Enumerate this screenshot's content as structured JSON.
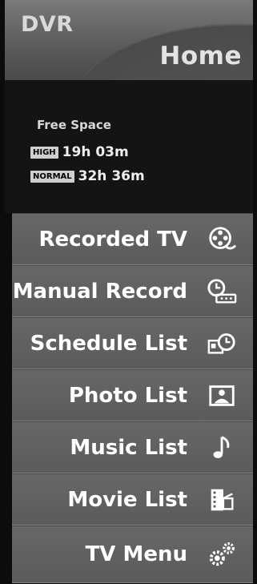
{
  "header": {
    "app": "DVR",
    "title": "Home"
  },
  "status": {
    "free_space_label": "Free Space",
    "high_badge": "HIGH",
    "high_time": "19h 03m",
    "normal_badge": "NORMAL",
    "normal_time": "32h 36m"
  },
  "menu": {
    "items": [
      {
        "label": "Recorded TV",
        "icon": "film-reel-icon"
      },
      {
        "label": "Manual Record",
        "icon": "clock-tape-icon"
      },
      {
        "label": "Schedule List",
        "icon": "calendar-clock-icon"
      },
      {
        "label": "Photo List",
        "icon": "photo-icon"
      },
      {
        "label": "Music List",
        "icon": "music-note-icon"
      },
      {
        "label": "Movie List",
        "icon": "clapperboard-icon"
      },
      {
        "label": "TV Menu",
        "icon": "gears-icon"
      }
    ]
  },
  "colors": {
    "background": "#0c0c0c",
    "menu_bg": "#5e5e5e",
    "header_bg": "#6a6a6a",
    "text": "#ffffff"
  }
}
